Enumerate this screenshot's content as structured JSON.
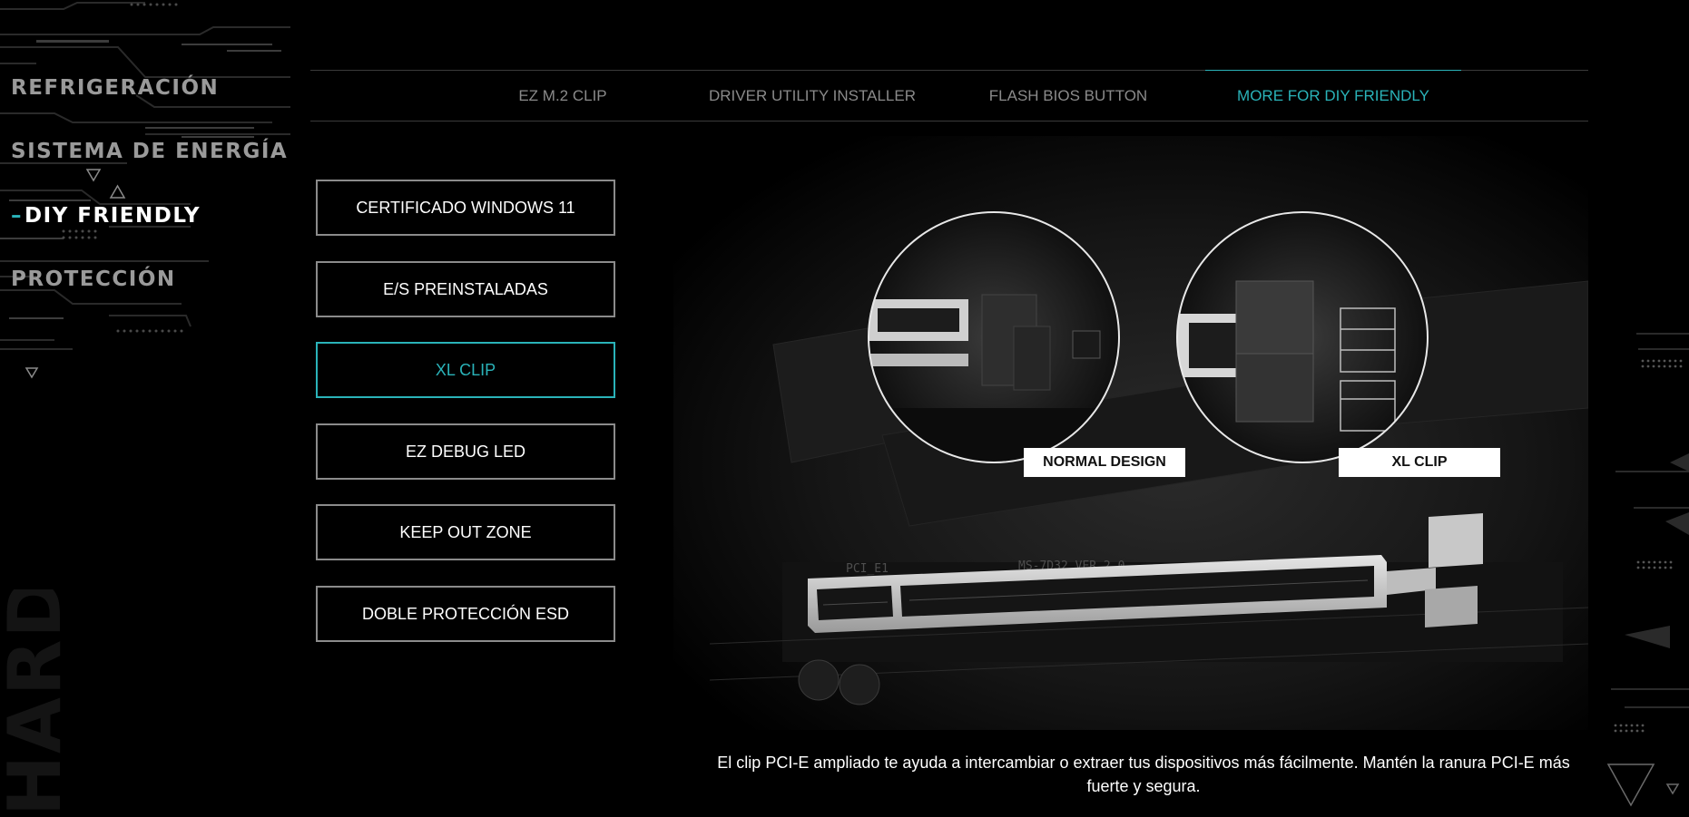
{
  "sidebar": {
    "items": [
      {
        "label": "REFRIGERACIÓN"
      },
      {
        "label": "SISTEMA DE ENERGÍA"
      },
      {
        "label": "DIY FRIENDLY"
      },
      {
        "label": "PROTECCIÓN"
      }
    ],
    "active_index": 2,
    "vertical_watermark": "HARDWARE"
  },
  "tabs": [
    {
      "label": "EZ M.2 CLIP"
    },
    {
      "label": "DRIVER UTILITY INSTALLER"
    },
    {
      "label": "FLASH BIOS BUTTON"
    },
    {
      "label": "MORE FOR DIY FRIENDLY"
    }
  ],
  "active_tab": 3,
  "features": [
    {
      "label": "CERTIFICADO WINDOWS 11"
    },
    {
      "label": "E/S PREINSTALADAS"
    },
    {
      "label": "XL CLIP"
    },
    {
      "label": "EZ DEBUG LED"
    },
    {
      "label": "KEEP OUT ZONE"
    },
    {
      "label": "DOBLE PROTECCIÓN ESD"
    }
  ],
  "active_feature": 2,
  "image": {
    "badge_left": "NORMAL DESIGN",
    "badge_right": "XL CLIP",
    "pcb_label": "PCI_E1",
    "pcb_text": "MS-7D32 VER 2.0"
  },
  "caption": "El clip PCI-E ampliado te ayuda a intercambiar o extraer tus dispositivos más fácilmente. Mantén la ranura PCI-E más fuerte y segura.",
  "colors": {
    "accent": "#2ab3b9",
    "background": "#000000",
    "inactive_text": "#8a8a8a",
    "button_border": "#8b8b8b"
  }
}
